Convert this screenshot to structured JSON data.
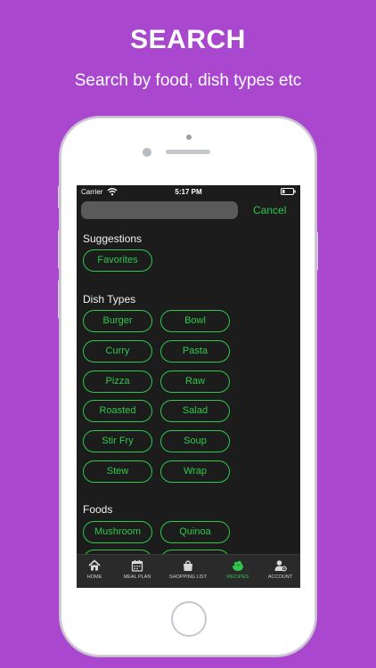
{
  "promo": {
    "headline": "SEARCH",
    "subline": "Search by food, dish types etc"
  },
  "status_bar": {
    "carrier": "Carrier",
    "time": "5:17 PM"
  },
  "search": {
    "value": "",
    "placeholder": "",
    "cancel_label": "Cancel"
  },
  "sections": {
    "suggestions": {
      "title": "Suggestions",
      "chips": [
        "Favorites"
      ]
    },
    "dish_types": {
      "title": "Dish Types",
      "chips": [
        "Burger",
        "Bowl",
        "Curry",
        "Pasta",
        "Pizza",
        "Raw",
        "Roasted",
        "Salad",
        "Stir Fry",
        "Soup",
        "Stew",
        "Wrap"
      ]
    },
    "foods": {
      "title": "Foods",
      "chips": [
        "Mushroom",
        "Quinoa"
      ]
    }
  },
  "tab_bar": {
    "items": [
      {
        "label": "HOME",
        "icon": "home-icon"
      },
      {
        "label": "MEAL PLAN",
        "icon": "calendar-icon"
      },
      {
        "label": "SHOPPING LIST",
        "icon": "shopping-bag-icon"
      },
      {
        "label": "RECIPES",
        "icon": "recipes-icon"
      },
      {
        "label": "ACCOUNT",
        "icon": "account-icon"
      }
    ],
    "active_index": 3
  },
  "colors": {
    "background": "#a948cf",
    "accent": "#2fc84b",
    "screen_bg": "#1c1c1c"
  }
}
